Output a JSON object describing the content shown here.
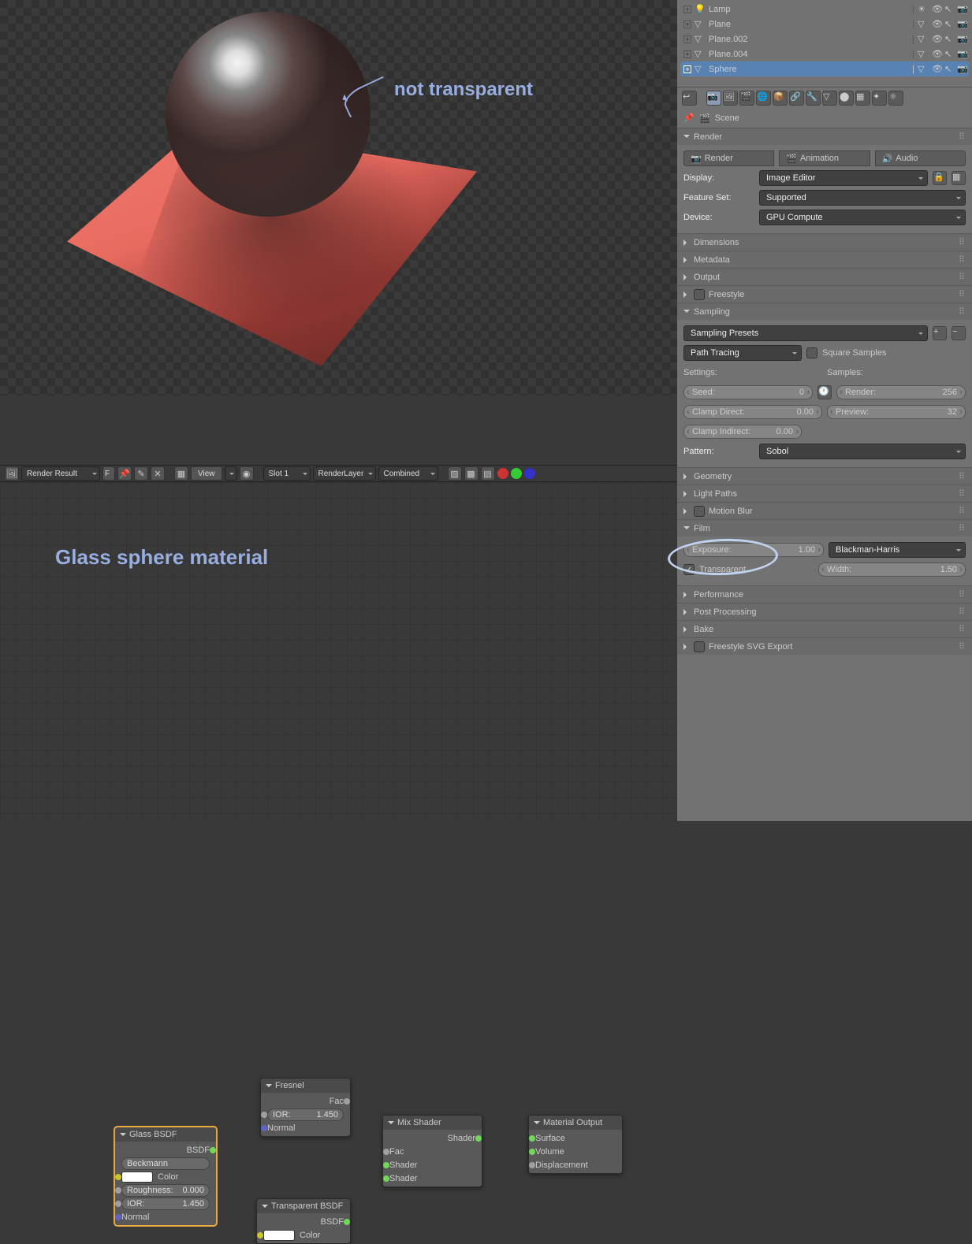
{
  "viewport": {
    "annotation": "not transparent"
  },
  "outliner": {
    "items": [
      {
        "name": "Lamp",
        "icon": "lamp",
        "selected": false
      },
      {
        "name": "Plane",
        "icon": "mesh",
        "selected": false
      },
      {
        "name": "Plane.002",
        "icon": "mesh",
        "selected": false
      },
      {
        "name": "Plane.004",
        "icon": "mesh",
        "selected": false
      },
      {
        "name": "Sphere",
        "icon": "mesh",
        "selected": true
      }
    ]
  },
  "breadcrumb": {
    "scene": "Scene"
  },
  "render_panel": {
    "render_btn": "Render",
    "anim_btn": "Animation",
    "audio_btn": "Audio",
    "display_label": "Display:",
    "display_val": "Image Editor",
    "feature_label": "Feature Set:",
    "feature_val": "Supported",
    "device_label": "Device:",
    "device_val": "GPU Compute"
  },
  "panels": {
    "render": "Render",
    "dimensions": "Dimensions",
    "metadata": "Metadata",
    "output": "Output",
    "freestyle": "Freestyle",
    "sampling": "Sampling",
    "geometry": "Geometry",
    "lightpaths": "Light Paths",
    "motionblur": "Motion Blur",
    "film": "Film",
    "performance": "Performance",
    "postproc": "Post Processing",
    "bake": "Bake",
    "svg": "Freestyle SVG Export"
  },
  "sampling": {
    "presets": "Sampling Presets",
    "integrator": "Path Tracing",
    "square_samples": "Square Samples",
    "settings_label": "Settings:",
    "samples_label": "Samples:",
    "seed_l": "Seed:",
    "seed_v": "0",
    "render_l": "Render:",
    "render_v": "256",
    "clampd_l": "Clamp Direct:",
    "clampd_v": "0.00",
    "preview_l": "Preview:",
    "preview_v": "32",
    "clampi_l": "Clamp Indirect:",
    "clampi_v": "0.00",
    "pattern_label": "Pattern:",
    "pattern_val": "Sobol"
  },
  "film": {
    "exposure_l": "Exposure:",
    "exposure_v": "1.00",
    "filter_val": "Blackman-Harris",
    "transparent": "Transparent",
    "width_l": "Width:",
    "width_v": "1.50"
  },
  "node_toolbar": {
    "image_name": "Render Result",
    "pin": "F",
    "view": "View",
    "slot": "Slot 1",
    "layer": "RenderLayer",
    "pass": "Combined"
  },
  "node_editor": {
    "title": "Glass sphere material",
    "glass": {
      "title": "Glass BSDF",
      "out": "BSDF",
      "dist": "Beckmann",
      "color": "Color",
      "rough_l": "Roughness:",
      "rough_v": "0.000",
      "ior_l": "IOR:",
      "ior_v": "1.450",
      "normal": "Normal"
    },
    "fresnel": {
      "title": "Fresnel",
      "out": "Fac",
      "ior_l": "IOR:",
      "ior_v": "1.450",
      "normal": "Normal"
    },
    "transparent": {
      "title": "Transparent BSDF",
      "out": "BSDF",
      "color": "Color"
    },
    "mix": {
      "title": "Mix Shader",
      "out": "Shader",
      "fac": "Fac",
      "sh1": "Shader",
      "sh2": "Shader"
    },
    "output": {
      "title": "Material Output",
      "surface": "Surface",
      "volume": "Volume",
      "disp": "Displacement"
    }
  }
}
